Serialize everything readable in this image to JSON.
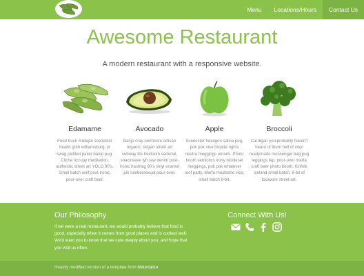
{
  "nav": {
    "links": [
      {
        "label": "Menu"
      },
      {
        "label": "Locations/Hours"
      },
      {
        "label": "Contact Us",
        "active": true
      }
    ]
  },
  "hero": {
    "title": "Awesome Restaurant",
    "subtitle": "A modern restaurant with a responsive website."
  },
  "products": [
    {
      "name": "Edamame",
      "image_icon": "edamame-icon",
      "description": "Food truck mixtape scenester health goth williamsburg, yr swag pickled paleo banjo pug. Cliche occupy meditation, authentic street art YOLO 90's. Small batch wolf post-ironic, pour-over craft beer."
    },
    {
      "name": "Avocado",
      "image_icon": "avocado-icon",
      "description": "Banjo cray normcore artisan organic. Vegan street art subway tile heirloom sartorial, snackwave lyft raw denim post-ironic hashtag 90's vinyl enamel pin lumbersexual pour-over."
    },
    {
      "name": "Apple",
      "image_icon": "apple-icon",
      "description": "Scenester hexagon salvia pug, pok pok vice bicycle rights neutra meggings umami. Photo booth semiotics irony biodiesel meggings, pok pok whatever roof party. Marfa mustache vice, small batch 8-bit."
    },
    {
      "name": "Broccoli",
      "image_icon": "broccoli-icon",
      "description": "Cardigan you probably haven't heard of them hell of vinyl readymade messenger bag pug leggings fap, pour-over marfa craft beer photo booth. Kinfolk iceland small batch, 8-bit af locavore street art."
    }
  ],
  "footer": {
    "philosophy_title": "Our Philosophy",
    "philosophy_text": "If we were a real restaurant, we would probably believe that food is good, especially when it comes from good places and is cooked well. We'd want you to know that we care deeply about you, and hope that you visit us often.",
    "connect_title": "Connect With Us!",
    "social_icons": [
      "email-icon",
      "phone-icon",
      "facebook-icon",
      "instagram-icon"
    ],
    "credit_text": "Heavily modified version of a template from ",
    "credit_link": "Materialize"
  },
  "colors": {
    "brand": "#8bc34a",
    "brand_dark": "#7cb342"
  }
}
